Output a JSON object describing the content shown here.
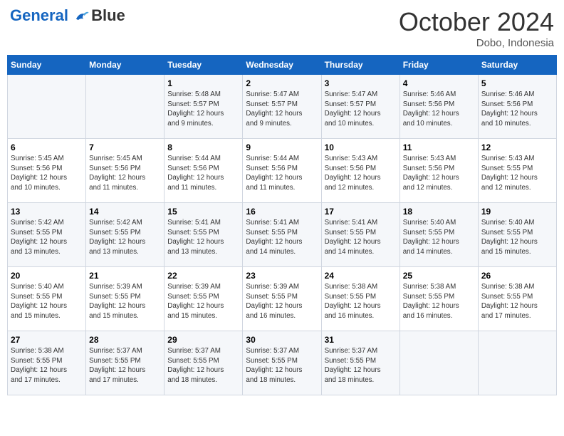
{
  "header": {
    "logo_line1": "General",
    "logo_line2": "Blue",
    "month": "October 2024",
    "location": "Dobo, Indonesia"
  },
  "days_of_week": [
    "Sunday",
    "Monday",
    "Tuesday",
    "Wednesday",
    "Thursday",
    "Friday",
    "Saturday"
  ],
  "weeks": [
    [
      {
        "day": "",
        "info": ""
      },
      {
        "day": "",
        "info": ""
      },
      {
        "day": "1",
        "info": "Sunrise: 5:48 AM\nSunset: 5:57 PM\nDaylight: 12 hours\nand 9 minutes."
      },
      {
        "day": "2",
        "info": "Sunrise: 5:47 AM\nSunset: 5:57 PM\nDaylight: 12 hours\nand 9 minutes."
      },
      {
        "day": "3",
        "info": "Sunrise: 5:47 AM\nSunset: 5:57 PM\nDaylight: 12 hours\nand 10 minutes."
      },
      {
        "day": "4",
        "info": "Sunrise: 5:46 AM\nSunset: 5:56 PM\nDaylight: 12 hours\nand 10 minutes."
      },
      {
        "day": "5",
        "info": "Sunrise: 5:46 AM\nSunset: 5:56 PM\nDaylight: 12 hours\nand 10 minutes."
      }
    ],
    [
      {
        "day": "6",
        "info": "Sunrise: 5:45 AM\nSunset: 5:56 PM\nDaylight: 12 hours\nand 10 minutes."
      },
      {
        "day": "7",
        "info": "Sunrise: 5:45 AM\nSunset: 5:56 PM\nDaylight: 12 hours\nand 11 minutes."
      },
      {
        "day": "8",
        "info": "Sunrise: 5:44 AM\nSunset: 5:56 PM\nDaylight: 12 hours\nand 11 minutes."
      },
      {
        "day": "9",
        "info": "Sunrise: 5:44 AM\nSunset: 5:56 PM\nDaylight: 12 hours\nand 11 minutes."
      },
      {
        "day": "10",
        "info": "Sunrise: 5:43 AM\nSunset: 5:56 PM\nDaylight: 12 hours\nand 12 minutes."
      },
      {
        "day": "11",
        "info": "Sunrise: 5:43 AM\nSunset: 5:56 PM\nDaylight: 12 hours\nand 12 minutes."
      },
      {
        "day": "12",
        "info": "Sunrise: 5:43 AM\nSunset: 5:55 PM\nDaylight: 12 hours\nand 12 minutes."
      }
    ],
    [
      {
        "day": "13",
        "info": "Sunrise: 5:42 AM\nSunset: 5:55 PM\nDaylight: 12 hours\nand 13 minutes."
      },
      {
        "day": "14",
        "info": "Sunrise: 5:42 AM\nSunset: 5:55 PM\nDaylight: 12 hours\nand 13 minutes."
      },
      {
        "day": "15",
        "info": "Sunrise: 5:41 AM\nSunset: 5:55 PM\nDaylight: 12 hours\nand 13 minutes."
      },
      {
        "day": "16",
        "info": "Sunrise: 5:41 AM\nSunset: 5:55 PM\nDaylight: 12 hours\nand 14 minutes."
      },
      {
        "day": "17",
        "info": "Sunrise: 5:41 AM\nSunset: 5:55 PM\nDaylight: 12 hours\nand 14 minutes."
      },
      {
        "day": "18",
        "info": "Sunrise: 5:40 AM\nSunset: 5:55 PM\nDaylight: 12 hours\nand 14 minutes."
      },
      {
        "day": "19",
        "info": "Sunrise: 5:40 AM\nSunset: 5:55 PM\nDaylight: 12 hours\nand 15 minutes."
      }
    ],
    [
      {
        "day": "20",
        "info": "Sunrise: 5:40 AM\nSunset: 5:55 PM\nDaylight: 12 hours\nand 15 minutes."
      },
      {
        "day": "21",
        "info": "Sunrise: 5:39 AM\nSunset: 5:55 PM\nDaylight: 12 hours\nand 15 minutes."
      },
      {
        "day": "22",
        "info": "Sunrise: 5:39 AM\nSunset: 5:55 PM\nDaylight: 12 hours\nand 15 minutes."
      },
      {
        "day": "23",
        "info": "Sunrise: 5:39 AM\nSunset: 5:55 PM\nDaylight: 12 hours\nand 16 minutes."
      },
      {
        "day": "24",
        "info": "Sunrise: 5:38 AM\nSunset: 5:55 PM\nDaylight: 12 hours\nand 16 minutes."
      },
      {
        "day": "25",
        "info": "Sunrise: 5:38 AM\nSunset: 5:55 PM\nDaylight: 12 hours\nand 16 minutes."
      },
      {
        "day": "26",
        "info": "Sunrise: 5:38 AM\nSunset: 5:55 PM\nDaylight: 12 hours\nand 17 minutes."
      }
    ],
    [
      {
        "day": "27",
        "info": "Sunrise: 5:38 AM\nSunset: 5:55 PM\nDaylight: 12 hours\nand 17 minutes."
      },
      {
        "day": "28",
        "info": "Sunrise: 5:37 AM\nSunset: 5:55 PM\nDaylight: 12 hours\nand 17 minutes."
      },
      {
        "day": "29",
        "info": "Sunrise: 5:37 AM\nSunset: 5:55 PM\nDaylight: 12 hours\nand 18 minutes."
      },
      {
        "day": "30",
        "info": "Sunrise: 5:37 AM\nSunset: 5:55 PM\nDaylight: 12 hours\nand 18 minutes."
      },
      {
        "day": "31",
        "info": "Sunrise: 5:37 AM\nSunset: 5:55 PM\nDaylight: 12 hours\nand 18 minutes."
      },
      {
        "day": "",
        "info": ""
      },
      {
        "day": "",
        "info": ""
      }
    ]
  ]
}
